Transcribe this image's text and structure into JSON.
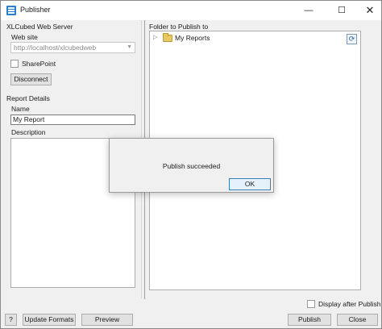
{
  "window": {
    "title": "Publisher",
    "minimize": "—",
    "maximize": "☐",
    "close": "✕"
  },
  "left_panel": {
    "server_group_label": "XLCubed Web Server",
    "website_label": "Web site",
    "website_value": "http://localhost/xlcubedweb",
    "sharepoint_label": "SharePoint",
    "disconnect_label": "Disconnect",
    "report_details_label": "Report Details",
    "name_label": "Name",
    "name_value": "My Report",
    "description_label": "Description"
  },
  "right_panel": {
    "folder_label": "Folder to Publish to",
    "tree": [
      {
        "label": "My Reports"
      }
    ],
    "refresh_icon": "refresh-icon"
  },
  "bottom_bar": {
    "help_label": "?",
    "update_formats_label": "Update Formats",
    "preview_label": "Preview",
    "display_after_publish_label": "Display after Publish",
    "publish_label": "Publish",
    "close_label": "Close"
  },
  "dialog": {
    "message": "Publish succeeded",
    "ok_label": "OK"
  },
  "colors": {
    "accent": "#3c7fb1",
    "folder": "#e8c766"
  }
}
